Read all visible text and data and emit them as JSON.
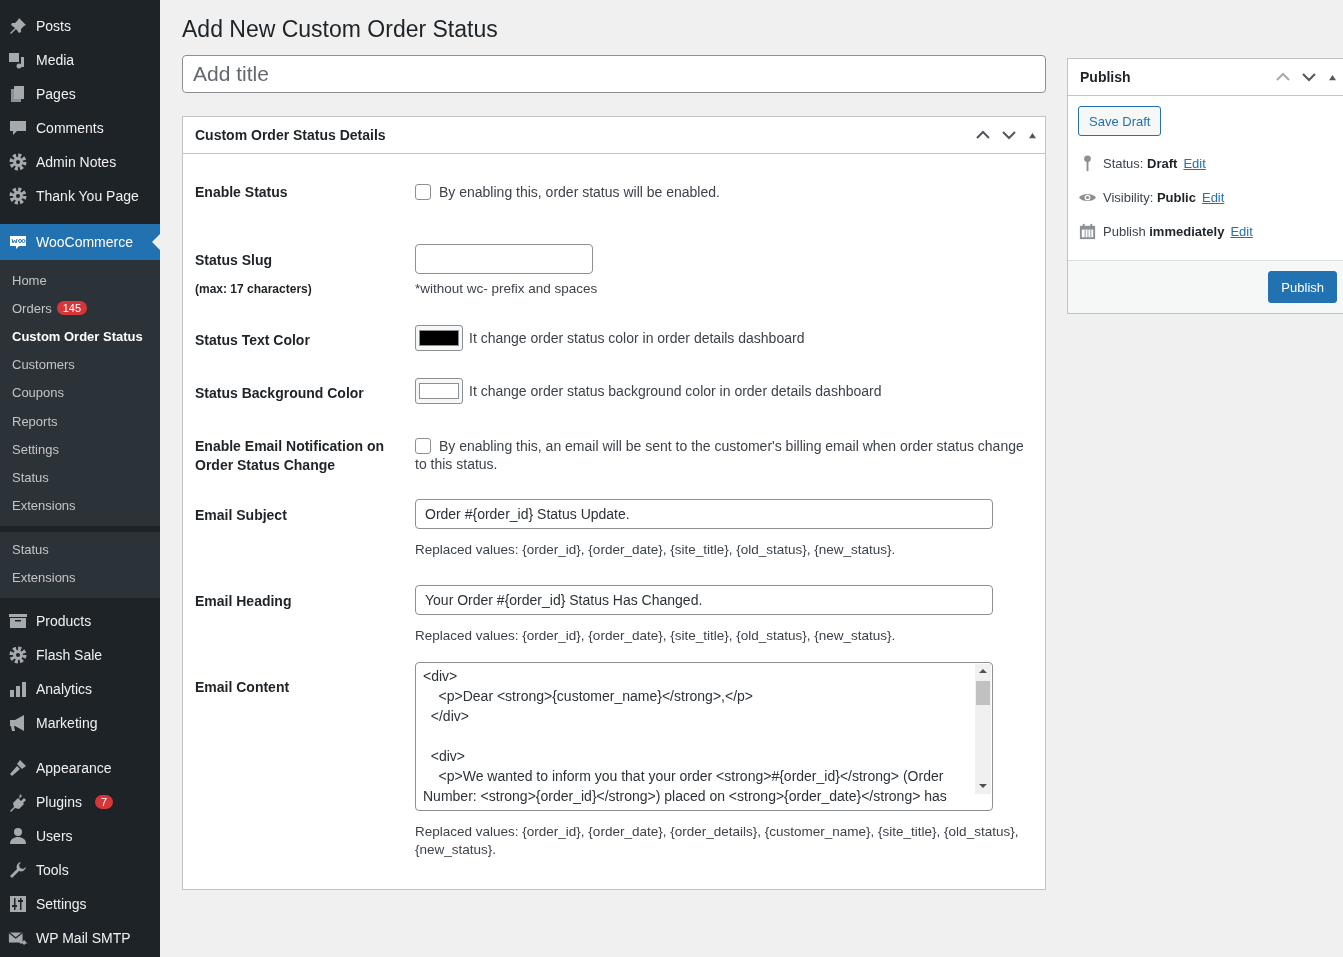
{
  "sidebar": {
    "groups": [
      [
        {
          "label": "Posts",
          "selected": false
        },
        {
          "label": "Media",
          "selected": false
        },
        {
          "label": "Pages",
          "selected": false
        },
        {
          "label": "Comments",
          "selected": false
        },
        {
          "label": "Admin Notes",
          "selected": false
        },
        {
          "label": "Thank You Page",
          "selected": false
        }
      ],
      [
        {
          "label": "WooCommerce",
          "selected": true,
          "submenu": [
            {
              "label": "Home",
              "selected": false
            },
            {
              "label": "Orders",
              "badge": "145",
              "selected": false
            },
            {
              "label": "Custom Order Status",
              "selected": true
            },
            {
              "label": "Customers",
              "selected": false
            },
            {
              "label": "Coupons",
              "selected": false
            },
            {
              "label": "Reports",
              "selected": false
            },
            {
              "label": "Settings",
              "selected": false
            },
            {
              "label": "Status",
              "selected": false
            },
            {
              "label": "Extensions",
              "selected": false
            }
          ],
          "submenu_2": [
            {
              "label": "Status",
              "selected": false
            },
            {
              "label": "Extensions",
              "selected": false
            }
          ]
        },
        {
          "label": "Products",
          "selected": false
        },
        {
          "label": "Flash Sale",
          "selected": false
        },
        {
          "label": "Analytics",
          "selected": false
        },
        {
          "label": "Marketing",
          "selected": false
        }
      ],
      [
        {
          "label": "Appearance",
          "selected": false
        },
        {
          "label": "Plugins",
          "badge": "7",
          "selected": false
        },
        {
          "label": "Users",
          "selected": false
        },
        {
          "label": "Tools",
          "selected": false
        },
        {
          "label": "Settings",
          "selected": false
        },
        {
          "label": "WP Mail SMTP",
          "selected": false
        }
      ]
    ]
  },
  "page_title": "Add New Custom Order Status",
  "title_field": {
    "placeholder": "Add title"
  },
  "details": {
    "title": "Custom Order Status Details",
    "fields": [
      {
        "kind": "checkbox",
        "label": "Enable Status",
        "checked": false,
        "text": "By enabling this, order status will be enabled."
      },
      {
        "kind": "short_text",
        "label": "Status Slug",
        "sublabel": "(max: 17 characters)",
        "help": "*without wc- prefix and spaces"
      },
      {
        "kind": "color",
        "label": "Status Text Color",
        "color": "#000000",
        "text": "It change order status color in order details dashboard"
      },
      {
        "kind": "color",
        "label": "Status Background Color",
        "color": "#ffffff",
        "text": "It change order status background color in order details dashboard"
      },
      {
        "kind": "checkbox",
        "label": "Enable Email Notification on Order Status Change",
        "checked": false,
        "text": "By enabling this, an email will be sent to the customer's billing email when order status change to this status."
      },
      {
        "kind": "text",
        "label": "Email Subject",
        "value": "Order #{order_id} Status Update.",
        "help": "Replaced values: {order_id}, {order_date}, {site_title}, {old_status}, {new_status}."
      },
      {
        "kind": "text",
        "label": "Email Heading",
        "value": "Your Order #{order_id} Status Has Changed.",
        "help": "Replaced values: {order_id}, {order_date}, {site_title}, {old_status}, {new_status}."
      },
      {
        "kind": "textarea",
        "label": "Email Content",
        "value": "<div>\n    <p>Dear <strong>{customer_name}</strong>,</p>\n  </div>\n\n  <div>\n    <p>We wanted to inform you that your order <strong>#{order_id}</strong> (Order Number: <strong>{order_id}</strong>) placed on <strong>{order_date}</strong> has",
        "help": "Replaced values: {order_id}, {order_date}, {order_details}, {customer_name}, {site_title}, {old_status}, {new_status}."
      }
    ]
  },
  "publish": {
    "title": "Publish",
    "save_draft": "Save Draft",
    "meta": [
      {
        "label": "Status:",
        "value": "Draft",
        "link": "Edit"
      },
      {
        "label": "Visibility:",
        "value": "Public",
        "link": "Edit"
      },
      {
        "label": "Publish",
        "value": "immediately",
        "link": "Edit"
      }
    ],
    "button": "Publish"
  }
}
